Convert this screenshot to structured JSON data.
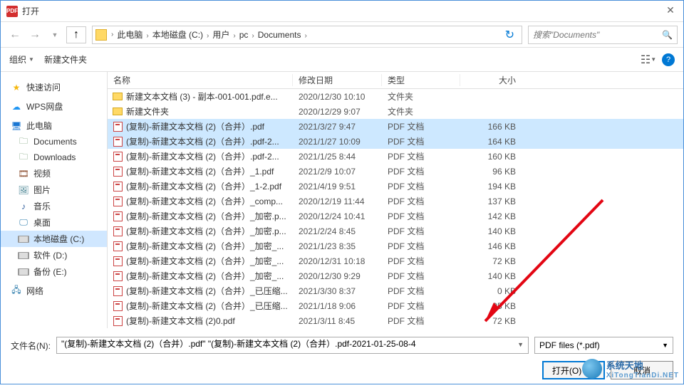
{
  "title": "打开",
  "nav": {
    "back": "←",
    "fwd": "→",
    "up": "↑",
    "refresh": "↻"
  },
  "breadcrumb": [
    "此电脑",
    "本地磁盘 (C:)",
    "用户",
    "pc",
    "Documents"
  ],
  "search": {
    "placeholder": "搜索\"Documents\""
  },
  "toolbar": {
    "organize": "组织",
    "newfolder": "新建文件夹"
  },
  "sidebar": [
    {
      "label": "快速访问",
      "icon": "star",
      "group": true
    },
    {
      "label": "WPS网盘",
      "icon": "cloud",
      "group": true
    },
    {
      "label": "此电脑",
      "icon": "pc",
      "group": true
    },
    {
      "label": "Documents",
      "icon": "folder"
    },
    {
      "label": "Downloads",
      "icon": "folder"
    },
    {
      "label": "视频",
      "icon": "video"
    },
    {
      "label": "图片",
      "icon": "pic"
    },
    {
      "label": "音乐",
      "icon": "music"
    },
    {
      "label": "桌面",
      "icon": "desktop"
    },
    {
      "label": "本地磁盘 (C:)",
      "icon": "disk",
      "sel": true
    },
    {
      "label": "软件 (D:)",
      "icon": "disk"
    },
    {
      "label": "备份 (E:)",
      "icon": "disk"
    },
    {
      "label": "网络",
      "icon": "net",
      "group": true
    }
  ],
  "columns": {
    "name": "名称",
    "date": "修改日期",
    "type": "类型",
    "size": "大小"
  },
  "files": [
    {
      "icon": "folder",
      "name": "新建文本文档 (3) - 副本-001-001.pdf.e...",
      "date": "2020/12/30 10:10",
      "type": "文件夹",
      "size": ""
    },
    {
      "icon": "folder",
      "name": "新建文件夹",
      "date": "2020/12/29 9:07",
      "type": "文件夹",
      "size": ""
    },
    {
      "icon": "pdf",
      "name": "(复制)-新建文本文档 (2)（合并）.pdf",
      "date": "2021/3/27 9:47",
      "type": "PDF 文档",
      "size": "166 KB",
      "sel": true
    },
    {
      "icon": "pdf",
      "name": "(复制)-新建文本文档 (2)（合并）.pdf-2...",
      "date": "2021/1/27 10:09",
      "type": "PDF 文档",
      "size": "164 KB",
      "sel": true
    },
    {
      "icon": "pdf",
      "name": "(复制)-新建文本文档 (2)（合并）.pdf-2...",
      "date": "2021/1/25 8:44",
      "type": "PDF 文档",
      "size": "160 KB"
    },
    {
      "icon": "pdf",
      "name": "(复制)-新建文本文档 (2)（合并）_1.pdf",
      "date": "2021/2/9 10:07",
      "type": "PDF 文档",
      "size": "96 KB"
    },
    {
      "icon": "pdf",
      "name": "(复制)-新建文本文档 (2)（合并）_1-2.pdf",
      "date": "2021/4/19 9:51",
      "type": "PDF 文档",
      "size": "194 KB"
    },
    {
      "icon": "pdf",
      "name": "(复制)-新建文本文档 (2)（合并）_comp...",
      "date": "2020/12/19 11:44",
      "type": "PDF 文档",
      "size": "137 KB"
    },
    {
      "icon": "pdf",
      "name": "(复制)-新建文本文档 (2)（合并）_加密.p...",
      "date": "2020/12/24 10:41",
      "type": "PDF 文档",
      "size": "142 KB"
    },
    {
      "icon": "pdf",
      "name": "(复制)-新建文本文档 (2)（合并）_加密.p...",
      "date": "2021/2/24 8:45",
      "type": "PDF 文档",
      "size": "140 KB"
    },
    {
      "icon": "pdf",
      "name": "(复制)-新建文本文档 (2)（合并）_加密_...",
      "date": "2021/1/23 8:35",
      "type": "PDF 文档",
      "size": "146 KB"
    },
    {
      "icon": "pdf",
      "name": "(复制)-新建文本文档 (2)（合并）_加密_...",
      "date": "2020/12/31 10:18",
      "type": "PDF 文档",
      "size": "72 KB"
    },
    {
      "icon": "pdf",
      "name": "(复制)-新建文本文档 (2)（合并）_加密_...",
      "date": "2020/12/30 9:29",
      "type": "PDF 文档",
      "size": "140 KB"
    },
    {
      "icon": "pdf",
      "name": "(复制)-新建文本文档 (2)（合并）_已压缩...",
      "date": "2021/3/30 8:37",
      "type": "PDF 文档",
      "size": "0 KB"
    },
    {
      "icon": "pdf",
      "name": "(复制)-新建文本文档 (2)（合并）_已压缩...",
      "date": "2021/1/18 9:06",
      "type": "PDF 文档",
      "size": "95 KB"
    },
    {
      "icon": "pdf",
      "name": "(复制)-新建文本文档 (2)0.pdf",
      "date": "2021/3/11 8:45",
      "type": "PDF 文档",
      "size": "72 KB"
    }
  ],
  "filename": {
    "label": "文件名(N):",
    "value": "\"(复制)-新建文本文档 (2)（合并）.pdf\" \"(复制)-新建文本文档 (2)（合并）.pdf-2021-01-25-08-4"
  },
  "filetype": "PDF files (*.pdf)",
  "buttons": {
    "open": "打开(O)",
    "cancel": "取消"
  },
  "watermark": {
    "line1": "系统天地",
    "line2": "XiTongTianDi.NET"
  }
}
